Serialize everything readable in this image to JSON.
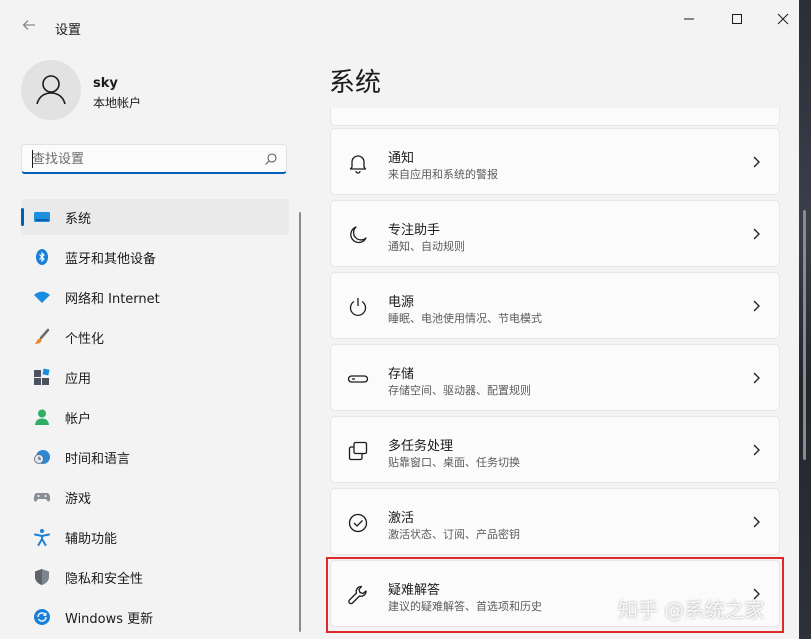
{
  "window": {
    "title": "设置",
    "back_icon": "back-arrow-icon"
  },
  "profile": {
    "name": "sky",
    "account_type": "本地帐户"
  },
  "search": {
    "placeholder": "查找设置"
  },
  "nav": {
    "items": [
      {
        "label": "系统",
        "icon": "system-display-icon",
        "selected": true
      },
      {
        "label": "蓝牙和其他设备",
        "icon": "bluetooth-icon"
      },
      {
        "label": "网络和 Internet",
        "icon": "wifi-icon"
      },
      {
        "label": "个性化",
        "icon": "brush-icon"
      },
      {
        "label": "应用",
        "icon": "apps-icon"
      },
      {
        "label": "帐户",
        "icon": "person-icon"
      },
      {
        "label": "时间和语言",
        "icon": "clock-globe-icon"
      },
      {
        "label": "游戏",
        "icon": "gamepad-icon"
      },
      {
        "label": "辅助功能",
        "icon": "accessibility-icon"
      },
      {
        "label": "隐私和安全性",
        "icon": "shield-icon"
      },
      {
        "label": "Windows 更新",
        "icon": "update-icon"
      }
    ]
  },
  "main": {
    "title": "系统",
    "cards": [
      {
        "title": "通知",
        "desc": "来自应用和系统的警报",
        "icon": "bell-icon"
      },
      {
        "title": "专注助手",
        "desc": "通知、自动规则",
        "icon": "moon-icon"
      },
      {
        "title": "电源",
        "desc": "睡眠、电池使用情况、节电模式",
        "icon": "power-icon"
      },
      {
        "title": "存储",
        "desc": "存储空间、驱动器、配置规则",
        "icon": "storage-drive-icon"
      },
      {
        "title": "多任务处理",
        "desc": "贴靠窗口、桌面、任务切换",
        "icon": "multitask-icon"
      },
      {
        "title": "激活",
        "desc": "激活状态、订阅、产品密钥",
        "icon": "checkmark-circle-icon"
      },
      {
        "title": "疑难解答",
        "desc": "建议的疑难解答、首选项和历史",
        "icon": "wrench-icon"
      }
    ]
  },
  "watermark": "知乎 @系统之家",
  "colors": {
    "accent": "#005fb8",
    "highlight_border": "#e02a2a",
    "background": "#f3f3f3",
    "card": "#fbfbfb"
  }
}
